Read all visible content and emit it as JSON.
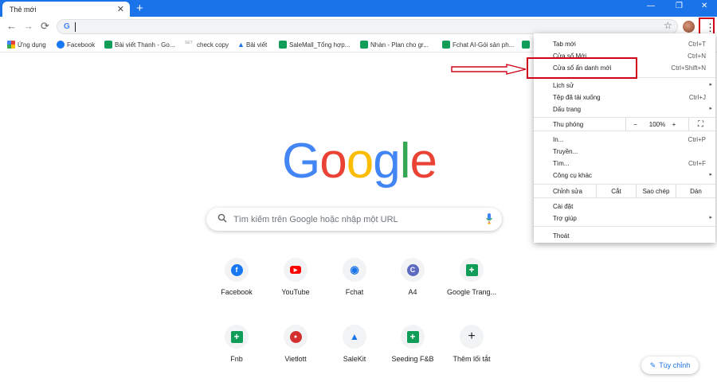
{
  "tab": {
    "title": "Thẻ mới",
    "close": "✕",
    "new_tab": "+"
  },
  "window_controls": {
    "minimize": "—",
    "maximize": "❐",
    "close": "✕"
  },
  "toolbar": {
    "back": "←",
    "forward": "→",
    "reload": "⟳",
    "omni_icon": "G",
    "star": "☆",
    "menu": "⋮"
  },
  "bookmarks": [
    {
      "label": "Ứng dụng",
      "icon": "apps-icon"
    },
    {
      "label": "Facebook",
      "icon": "facebook-icon"
    },
    {
      "label": "Bài viết Thanh - Go...",
      "icon": "sheets-icon"
    },
    {
      "label": "check copy",
      "icon": "set-icon"
    },
    {
      "label": "Bài viết",
      "icon": "a-icon"
    },
    {
      "label": "SaleMall_Tổng hợp...",
      "icon": "sheets-icon"
    },
    {
      "label": "Nhàn - Plan cho gr...",
      "icon": "sheets-icon"
    },
    {
      "label": "Fchat AI-Gói sản ph...",
      "icon": "sheets-icon"
    }
  ],
  "bookmark_set_text": "SET",
  "logo": [
    "G",
    "o",
    "o",
    "g",
    "l",
    "e"
  ],
  "logo_colors": [
    "#4285f4",
    "#ea4335",
    "#fbbc05",
    "#4285f4",
    "#34a853",
    "#ea4335"
  ],
  "search": {
    "placeholder": "Tìm kiếm trên Google hoặc nhập một URL",
    "icon": "🔍"
  },
  "shortcuts": [
    {
      "label": "Facebook",
      "glyph": "f",
      "color": "#1877f2"
    },
    {
      "label": "YouTube",
      "glyph": "▶",
      "color": "#ff0000"
    },
    {
      "label": "Fchat",
      "glyph": "◉",
      "color": "#1a73e8"
    },
    {
      "label": "A4",
      "glyph": "C",
      "color": "#5c6bc0"
    },
    {
      "label": "Google Trang...",
      "glyph": "+",
      "color": "#0f9d58"
    },
    {
      "label": "Fnb",
      "glyph": "+",
      "color": "#0f9d58"
    },
    {
      "label": "Vietlott",
      "glyph": "●",
      "color": "#d32f2f"
    },
    {
      "label": "SaleKit",
      "glyph": "▲",
      "color": "#1a73e8"
    },
    {
      "label": "Seeding F&B",
      "glyph": "+",
      "color": "#0f9d58"
    },
    {
      "label": "Thêm lối tắt",
      "glyph": "+",
      "color": "#202124"
    }
  ],
  "customize": {
    "icon": "✎",
    "label": "Tùy chỉnh"
  },
  "menu": {
    "items": [
      {
        "label": "Tab mới",
        "shortcut": "Ctrl+T"
      },
      {
        "label": "Cửa sổ Mới",
        "shortcut": "Ctrl+N"
      },
      {
        "label": "Cửa sổ ẩn danh mới",
        "shortcut": "Ctrl+Shift+N"
      },
      {
        "label": "Lịch sử",
        "shortcut": "▸"
      },
      {
        "label": "Tệp đã tải xuống",
        "shortcut": "Ctrl+J"
      },
      {
        "label": "Dấu trang",
        "shortcut": "▸"
      },
      {
        "label": "In...",
        "shortcut": "Ctrl+P"
      },
      {
        "label": "Truyền...",
        "shortcut": ""
      },
      {
        "label": "Tìm...",
        "shortcut": "Ctrl+F"
      },
      {
        "label": "Công cụ khác",
        "shortcut": "▸"
      },
      {
        "label": "Cài đặt",
        "shortcut": ""
      },
      {
        "label": "Trợ giúp",
        "shortcut": "▸"
      },
      {
        "label": "Thoát",
        "shortcut": ""
      }
    ],
    "zoom": {
      "label": "Thu phóng",
      "minus": "−",
      "value": "100%",
      "plus": "+",
      "fullscreen": "⛶"
    },
    "edit": {
      "label": "Chỉnh sửa",
      "cut": "Cắt",
      "copy": "Sao chép",
      "paste": "Dán"
    }
  },
  "colors": {
    "chrome_blue": "#1a73e8",
    "annotation_red": "#d0021b"
  }
}
